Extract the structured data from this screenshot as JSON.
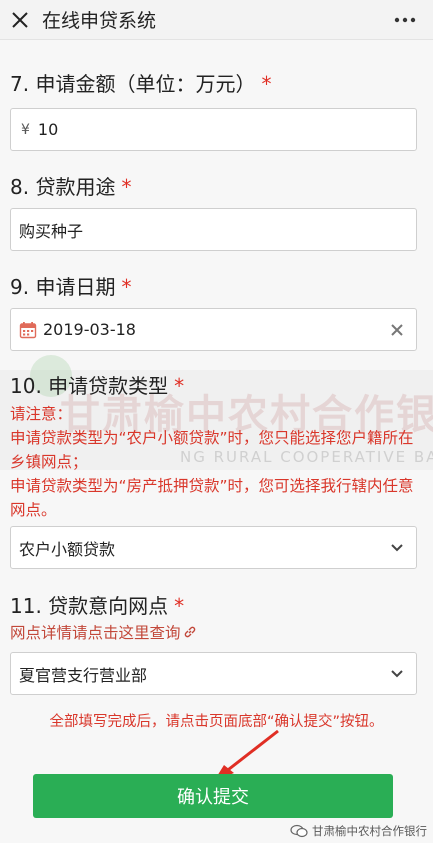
{
  "header": {
    "title": "在线申贷系统",
    "close_icon": "close-icon",
    "more_icon": "more-icon"
  },
  "q7": {
    "title": "7. 申请金额（单位：万元）",
    "required_mark": "*",
    "prefix": "¥",
    "value": "10"
  },
  "q8": {
    "title": "8. 贷款用途",
    "required_mark": "*",
    "value": "购买种子"
  },
  "q9": {
    "title": "9. 申请日期",
    "required_mark": "*",
    "value": "2019-03-18"
  },
  "q10": {
    "title": "10. 申请贷款类型",
    "required_mark": "*",
    "note_lines": [
      "请注意：",
      "申请贷款类型为“农户小额贷款”时，您只能选择您户籍所在乡镇网点；",
      "申请贷款类型为“房产抵押贷款”时，您可选择我行辖内任意网点。"
    ],
    "selected": "农户小额贷款"
  },
  "q11": {
    "title": "11. 贷款意向网点",
    "required_mark": "*",
    "link": "网点详情请点击这里查询",
    "selected": "夏官营支行营业部"
  },
  "hint": "全部填写完成后，请点击页面底部“确认提交”按钮。",
  "submit_label": "确认提交",
  "watermark": {
    "cn": "甘肃榆中农村合作银行",
    "en": "NG RURAL COOPERATIVE BANK"
  },
  "signature": "甘肃榆中农村合作银行",
  "colors": {
    "accent_green": "#2aae55",
    "required_red": "#e02e24",
    "note_red": "#d9372b"
  }
}
